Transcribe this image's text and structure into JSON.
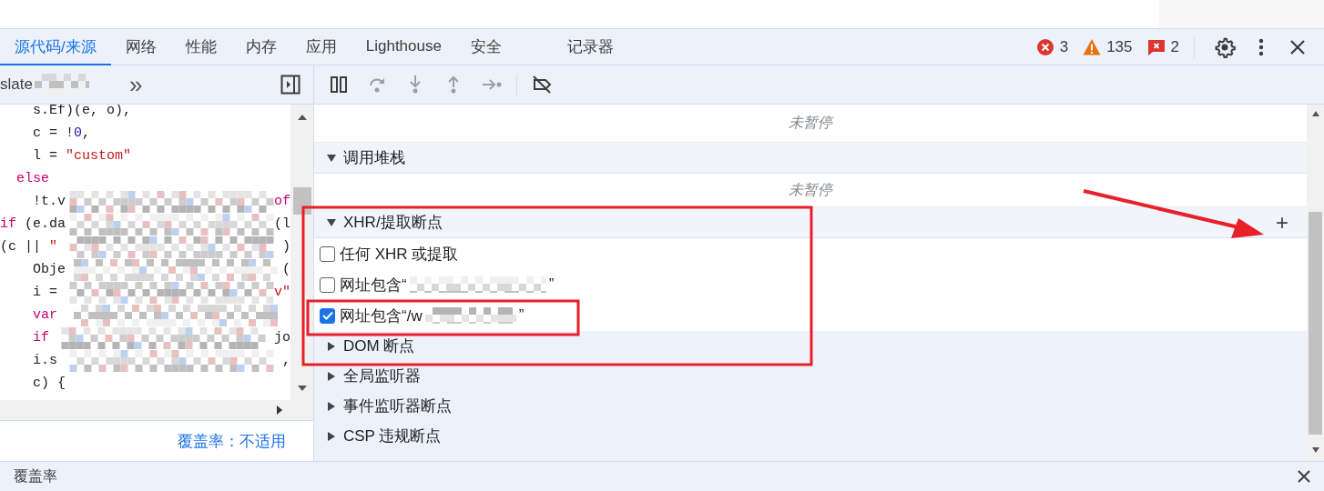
{
  "tabs": [
    {
      "label": "源代码/来源",
      "selected": true
    },
    {
      "label": "网络",
      "selected": false
    },
    {
      "label": "性能",
      "selected": false
    },
    {
      "label": "内存",
      "selected": false
    },
    {
      "label": "应用",
      "selected": false
    },
    {
      "label": "Lighthouse",
      "selected": false
    },
    {
      "label": "安全",
      "selected": false
    },
    {
      "label": "记录器",
      "selected": false
    }
  ],
  "status_counts": [
    {
      "kind": "error",
      "count": "3"
    },
    {
      "kind": "warning",
      "count": "135"
    },
    {
      "kind": "issue",
      "count": "2"
    }
  ],
  "navigator": {
    "file_label": "slate",
    "more_label": "»"
  },
  "code_lines": [
    {
      "prefix": [
        {
          "text": "    s.Ef)(e, o),",
          "kind": "plain"
        }
      ],
      "redacted": false
    },
    {
      "prefix": [
        {
          "text": "    c = !",
          "kind": "plain"
        },
        {
          "text": "0",
          "kind": "number"
        },
        {
          "text": ",",
          "kind": "plain"
        }
      ],
      "redacted": false
    },
    {
      "prefix": [
        {
          "text": "    l = ",
          "kind": "plain"
        },
        {
          "text": "\"custom\"",
          "kind": "string"
        }
      ],
      "redacted": false
    },
    {
      "prefix": [
        {
          "text": "  else",
          "kind": "keyword"
        }
      ],
      "redacted": false
    },
    {
      "prefix": [
        {
          "text": "    !t.v",
          "kind": "plain"
        }
      ],
      "redacted": true,
      "suffix": [
        {
          "text": "of",
          "kind": "keyword"
        }
      ]
    },
    {
      "prefix": [
        {
          "text": "if",
          "kind": "keyword"
        },
        {
          "text": " (e.da",
          "kind": "plain"
        }
      ],
      "redacted": true,
      "suffix": [
        {
          "text": "(l",
          "kind": "plain"
        }
      ]
    },
    {
      "prefix": [
        {
          "text": "(c || ",
          "kind": "plain"
        },
        {
          "text": "\"",
          "kind": "string"
        }
      ],
      "redacted": true,
      "suffix": [
        {
          "text": ")",
          "kind": "plain"
        }
      ]
    },
    {
      "prefix": [
        {
          "text": "    Obje",
          "kind": "plain"
        }
      ],
      "redacted": true,
      "suffix": [
        {
          "text": "(",
          "kind": "plain"
        }
      ]
    },
    {
      "prefix": [
        {
          "text": "    i = ",
          "kind": "plain"
        }
      ],
      "redacted": true,
      "suffix": [
        {
          "text": "v\"",
          "kind": "string"
        }
      ]
    },
    {
      "prefix": [
        {
          "text": "    var",
          "kind": "keyword"
        }
      ],
      "redacted": true
    },
    {
      "prefix": [
        {
          "text": "    if",
          "kind": "keyword"
        }
      ],
      "redacted": true,
      "suffix": [
        {
          "text": "jo",
          "kind": "plain"
        }
      ]
    },
    {
      "prefix": [
        {
          "text": "    i.s",
          "kind": "plain"
        }
      ],
      "redacted": true,
      "suffix": [
        {
          "text": ",",
          "kind": "plain"
        }
      ]
    },
    {
      "prefix": [
        {
          "text": "    c) {",
          "kind": "plain"
        }
      ],
      "redacted": false
    }
  ],
  "coverage_link": "覆盖率：不适用",
  "debugger_buttons": [
    {
      "kind": "pause",
      "disabled": false
    },
    {
      "kind": "step-over",
      "disabled": true
    },
    {
      "kind": "step-into",
      "disabled": true
    },
    {
      "kind": "step-out",
      "disabled": true
    },
    {
      "kind": "step",
      "disabled": true
    },
    {
      "kind": "deactivate",
      "disabled": false
    }
  ],
  "sections": [
    {
      "kind": "message",
      "text": "未暂停"
    },
    {
      "kind": "header",
      "label": "调用堆栈",
      "expanded": true
    },
    {
      "kind": "message",
      "text": "未暂停"
    },
    {
      "kind": "header",
      "label": "XHR/提取断点",
      "expanded": true,
      "add_label": "+"
    },
    {
      "kind": "checkbox",
      "label": "任何 XHR 或提取",
      "checked": false,
      "redacted": false
    },
    {
      "kind": "checkbox",
      "label": "网址包含“",
      "checked": false,
      "redacted": true,
      "suffix": "”"
    },
    {
      "kind": "checkbox",
      "label": "网址包含“/w",
      "checked": true,
      "redacted": true,
      "suffix": "”"
    },
    {
      "kind": "header",
      "label": "DOM 断点",
      "expanded": false
    },
    {
      "kind": "header",
      "label": "全局监听器",
      "expanded": false
    },
    {
      "kind": "header",
      "label": "事件监听器断点",
      "expanded": false
    },
    {
      "kind": "header",
      "label": "CSP 违规断点",
      "expanded": false
    }
  ],
  "drawer": {
    "tab_label": "覆盖率"
  }
}
